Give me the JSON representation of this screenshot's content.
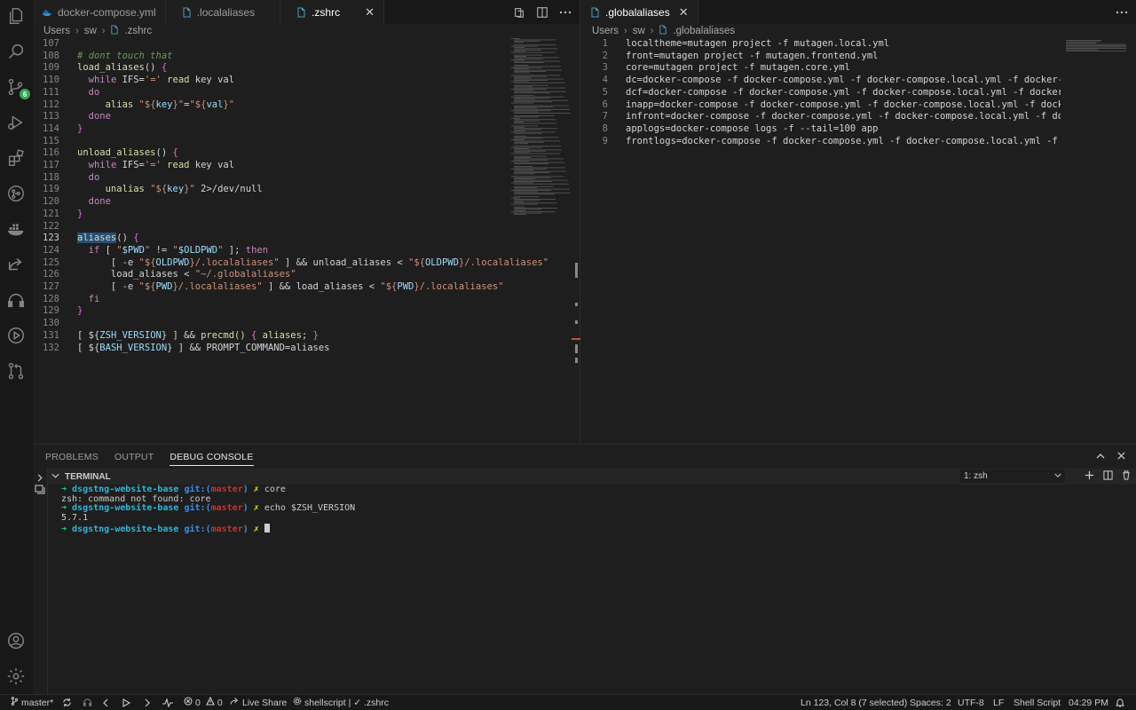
{
  "tabs_left": [
    {
      "label": "docker-compose.yml",
      "icon": "docker-file-icon",
      "active": false
    },
    {
      "label": ".localaliases",
      "icon": "file-icon",
      "active": false
    },
    {
      "label": ".zshrc",
      "icon": "file-icon",
      "active": true,
      "close": "✕"
    }
  ],
  "tabs_right": [
    {
      "label": ".globalaliases",
      "icon": "file-icon",
      "active": true,
      "close": "✕"
    }
  ],
  "breadcrumb_left": [
    "Users",
    "sw",
    ".zshrc"
  ],
  "breadcrumb_right": [
    "Users",
    "sw",
    ".globalaliases"
  ],
  "editor_left": {
    "lines": [
      {
        "n": "107",
        "html": ""
      },
      {
        "n": "108",
        "html": "<span class='tk-comment'># dont touch that</span>"
      },
      {
        "n": "109",
        "html": "<span class='tk-func'>load_aliases</span>() <span class='tk-brace'>{</span>"
      },
      {
        "n": "110",
        "html": "  <span class='tk-kw'>while</span> IFS=<span class='tk-str'>'='</span> <span class='tk-func'>read</span> key val"
      },
      {
        "n": "111",
        "html": "  <span class='tk-kw'>do</span>"
      },
      {
        "n": "112",
        "html": "     <span class='tk-func'>alias</span> <span class='tk-str'>\"${<span class='tk-var'>key</span>}\"</span>=<span class='tk-str'>\"${<span class='tk-var'>val</span>}\"</span>"
      },
      {
        "n": "113",
        "html": "  <span class='tk-kw'>done</span>"
      },
      {
        "n": "114",
        "html": "<span class='tk-brace'>}</span>"
      },
      {
        "n": "115",
        "html": ""
      },
      {
        "n": "116",
        "html": "<span class='tk-func'>unload_aliases</span>() <span class='tk-brace'>{</span>"
      },
      {
        "n": "117",
        "html": "  <span class='tk-kw'>while</span> IFS=<span class='tk-str'>'='</span> <span class='tk-func'>read</span> key val"
      },
      {
        "n": "118",
        "html": "  <span class='tk-kw'>do</span>"
      },
      {
        "n": "119",
        "html": "     <span class='tk-func'>unalias</span> <span class='tk-str'>\"${<span class='tk-var'>key</span>}\"</span> 2&gt;/dev/null"
      },
      {
        "n": "120",
        "html": "  <span class='tk-kw'>done</span>"
      },
      {
        "n": "121",
        "html": "<span class='tk-brace'>}</span>"
      },
      {
        "n": "122",
        "html": ""
      },
      {
        "n": "123",
        "html": "<span class='tk-func tk-sel'>aliases</span>() <span class='tk-brace'>{</span>",
        "current": true
      },
      {
        "n": "124",
        "html": "  <span class='tk-kw'>if</span> [ <span class='tk-str'>\"<span class='tk-var'>$PWD</span>\"</span> != <span class='tk-str'>\"<span class='tk-var'>$OLDPWD</span>\"</span> ]; <span class='tk-kw'>then</span>"
      },
      {
        "n": "125",
        "html": "      [ -e <span class='tk-str'>\"${<span class='tk-var'>OLDPWD</span>}/.localaliases\"</span> ] &amp;&amp; unload_aliases &lt; <span class='tk-str'>\"${<span class='tk-var'>OLDPWD</span>}/.localaliases\"</span>"
      },
      {
        "n": "126",
        "html": "      load_aliases &lt; <span class='tk-str'>\"~/.globalaliases\"</span>"
      },
      {
        "n": "127",
        "html": "      [ -e <span class='tk-str'>\"${<span class='tk-var'>PWD</span>}/.localaliases\"</span> ] &amp;&amp; load_aliases &lt; <span class='tk-str'>\"${<span class='tk-var'>PWD</span>}/.localaliases\"</span>"
      },
      {
        "n": "128",
        "html": "  <span class='tk-kw'>fi</span>"
      },
      {
        "n": "129",
        "html": "<span class='tk-brace'>}</span>"
      },
      {
        "n": "130",
        "html": ""
      },
      {
        "n": "131",
        "html": "[ ${<span class='tk-var'>ZSH_VERSION</span>} ] &amp;&amp; <span class='tk-func'>precmd</span>() <span class='tk-brace'>{</span> <span class='tk-func'>aliases</span>; <span class='tk-brace'>}</span>"
      },
      {
        "n": "132",
        "html": "[ ${<span class='tk-var'>BASH_VERSION</span>} ] &amp;&amp; PROMPT_COMMAND=aliases"
      }
    ]
  },
  "editor_right": {
    "lines": [
      {
        "n": "1",
        "text": "localtheme=mutagen project -f mutagen.local.yml"
      },
      {
        "n": "2",
        "text": "front=mutagen project -f mutagen.frontend.yml"
      },
      {
        "n": "3",
        "text": "core=mutagen project -f mutagen.core.yml"
      },
      {
        "n": "4",
        "text": "dc=docker-compose -f docker-compose.yml -f docker-compose.local.yml -f docker-compose.ssl"
      },
      {
        "n": "5",
        "text": "dcf=docker-compose -f docker-compose.yml -f docker-compose.local.yml -f docker-compose.ss"
      },
      {
        "n": "6",
        "text": "inapp=docker-compose -f docker-compose.yml -f docker-compose.local.yml -f docker-compose."
      },
      {
        "n": "7",
        "text": "infront=docker-compose -f docker-compose.yml -f docker-compose.local.yml -f docker-compos"
      },
      {
        "n": "8",
        "text": "applogs=docker-compose logs -f --tail=100 app"
      },
      {
        "n": "9",
        "text": "frontlogs=docker-compose -f docker-compose.yml -f docker-compose.local.yml -f docker-comp"
      }
    ]
  },
  "panel": {
    "tabs": [
      "PROBLEMS",
      "OUTPUT",
      "DEBUG CONSOLE"
    ],
    "active_tab": "DEBUG CONSOLE",
    "terminal_title": "TERMINAL",
    "terminal_select": "1: zsh",
    "terminal_lines": [
      {
        "type": "prompt",
        "arrow": "➜",
        "dir": "dsgstng-website-base",
        "git": "git:(",
        "branch": "master",
        "gitclose": ")",
        "x": "✗",
        "cmd": "core"
      },
      {
        "type": "out",
        "text": "zsh: command not found: core"
      },
      {
        "type": "prompt",
        "arrow": "➜",
        "dir": "dsgstng-website-base",
        "git": "git:(",
        "branch": "master",
        "gitclose": ")",
        "x": "✗",
        "cmd": "echo $ZSH_VERSION"
      },
      {
        "type": "out",
        "text": "5.7.1"
      },
      {
        "type": "prompt",
        "arrow": "➜",
        "dir": "dsgstng-website-base",
        "git": "git:(",
        "branch": "master",
        "gitclose": ")",
        "x": "✗",
        "cmd": "",
        "cursor": true
      }
    ]
  },
  "activity_badge": "6",
  "statusbar": {
    "branch": "master*",
    "errors": "0",
    "warnings": "0",
    "live_share": "Live Share",
    "linter": "shellscript | ✓ .zshrc",
    "position": "Ln 123, Col 8 (7 selected)",
    "spaces": "Spaces: 2",
    "encoding": "UTF-8",
    "eol": "LF",
    "language": "Shell Script",
    "time": "04:29 PM"
  },
  "colors": {
    "background": "#1e1e1e",
    "sidebar": "#181818",
    "accent": "#0078d4",
    "badge": "#35a852"
  }
}
